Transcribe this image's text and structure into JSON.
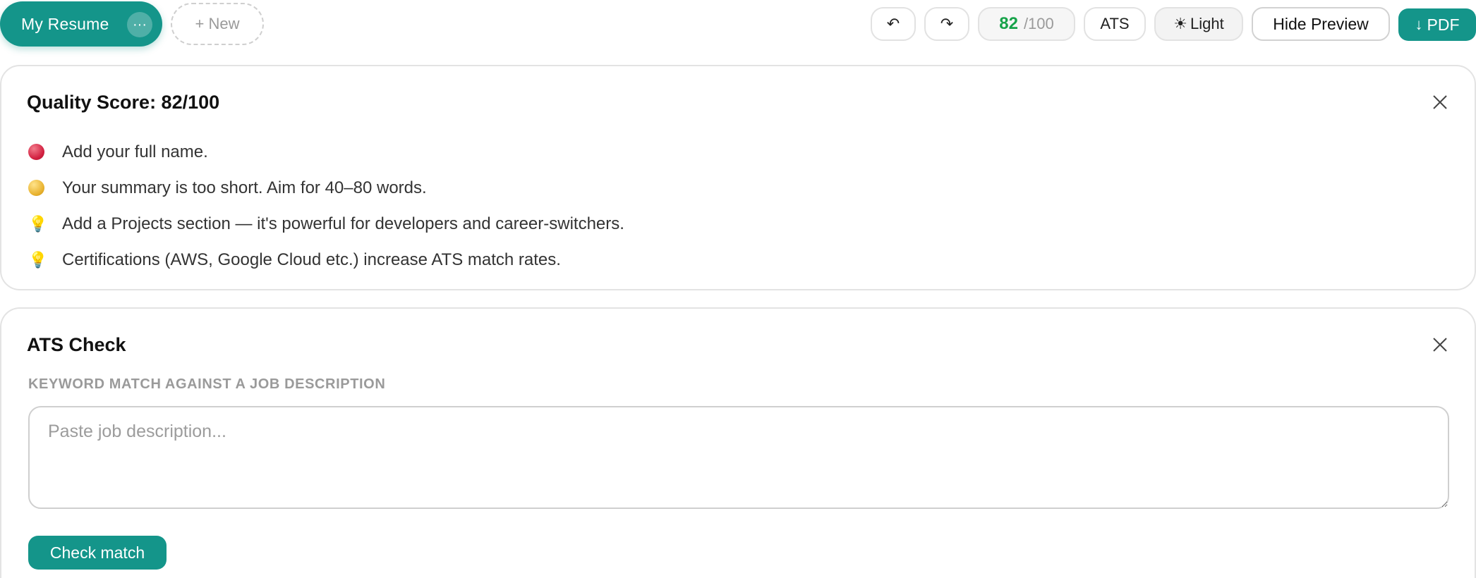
{
  "topbar": {
    "resume_tab": "My Resume",
    "more_glyph": "···",
    "new_button": "+ New",
    "undo_glyph": "↶",
    "redo_glyph": "↷",
    "score_value": "82",
    "score_max": "/100",
    "ats_button": "ATS",
    "theme_glyph": "☀",
    "theme_button": "Light",
    "hide_preview_button": "Hide Preview",
    "pdf_glyph": "↓",
    "pdf_button": "PDF"
  },
  "quality": {
    "title": "Quality Score: 82/100",
    "items": [
      {
        "icon": "red-dot-icon",
        "text": "Add your full name."
      },
      {
        "icon": "yellow-dot-icon",
        "text": "Your summary is too short. Aim for 40–80 words."
      },
      {
        "icon": "lightbulb-icon",
        "text": "Add a Projects section — it's powerful for developers and career-switchers."
      },
      {
        "icon": "lightbulb-icon",
        "text": "Certifications (AWS, Google Cloud etc.) increase ATS match rates."
      }
    ]
  },
  "ats": {
    "title": "ATS Check",
    "subtitle": "KEYWORD MATCH AGAINST A JOB DESCRIPTION",
    "placeholder": "Paste job description...",
    "check_button": "Check match"
  },
  "colors": {
    "accent": "#14958a",
    "score_green": "#17a34a",
    "error_red": "#d11f3f",
    "warning_yellow": "#e8b22e"
  }
}
